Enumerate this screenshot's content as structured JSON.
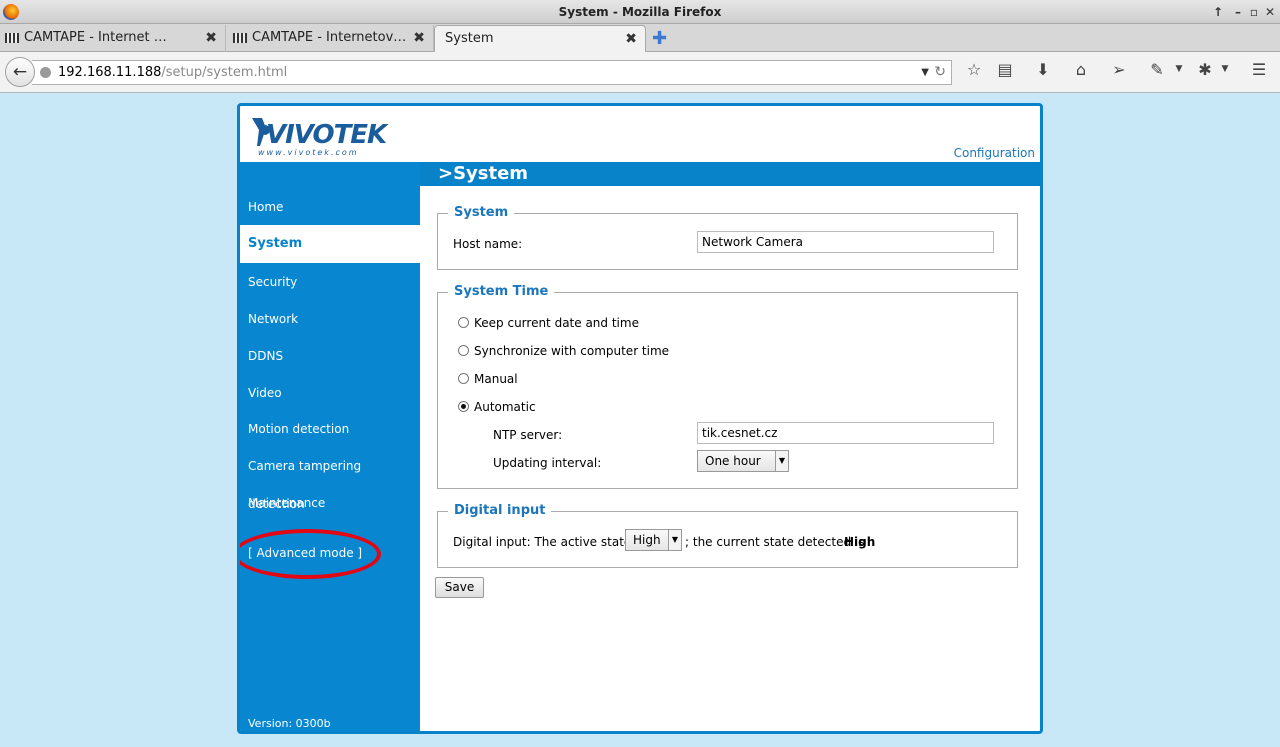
{
  "window": {
    "title": "System - Mozilla Firefox"
  },
  "tabs": [
    {
      "label": "CAMTAPE - Internet …"
    },
    {
      "label": "CAMTAPE - Internetov…"
    },
    {
      "label": "System"
    }
  ],
  "url": {
    "host": "192.168.11.188",
    "path": "/setup/system.html"
  },
  "page": {
    "logo_text": "VIVOTEK",
    "logo_sub": "www.vivotek.com",
    "config_link": "Configuration",
    "header": ">System",
    "menu": [
      {
        "label": "Home"
      },
      {
        "label": "System"
      },
      {
        "label": "Security"
      },
      {
        "label": "Network"
      },
      {
        "label": "DDNS"
      },
      {
        "label": "Video"
      },
      {
        "label": "Motion detection"
      },
      {
        "label": "Camera tampering detection"
      },
      {
        "label": "Maintenance"
      }
    ],
    "advanced_mode": "[ Advanced mode ]",
    "version": "Version: 0300b",
    "system": {
      "legend": "System",
      "host_label": "Host name:",
      "host_value": "Network Camera"
    },
    "system_time": {
      "legend": "System Time",
      "options": [
        {
          "label": "Keep current date and time",
          "selected": false
        },
        {
          "label": "Synchronize with computer time",
          "selected": false
        },
        {
          "label": "Manual",
          "selected": false
        },
        {
          "label": "Automatic",
          "selected": true
        }
      ],
      "ntp_label": "NTP server:",
      "ntp_value": "tik.cesnet.cz",
      "interval_label": "Updating interval:",
      "interval_value": "One hour"
    },
    "digital_input": {
      "legend": "Digital input",
      "text_before": "Digital input: The active state is",
      "active_state": "High",
      "text_after": "; the current state detected is",
      "current_state": "High"
    },
    "save_label": "Save"
  },
  "colors": {
    "brand": "#0882c8",
    "annotation": "#e30613",
    "background": "#c8e8f8"
  }
}
